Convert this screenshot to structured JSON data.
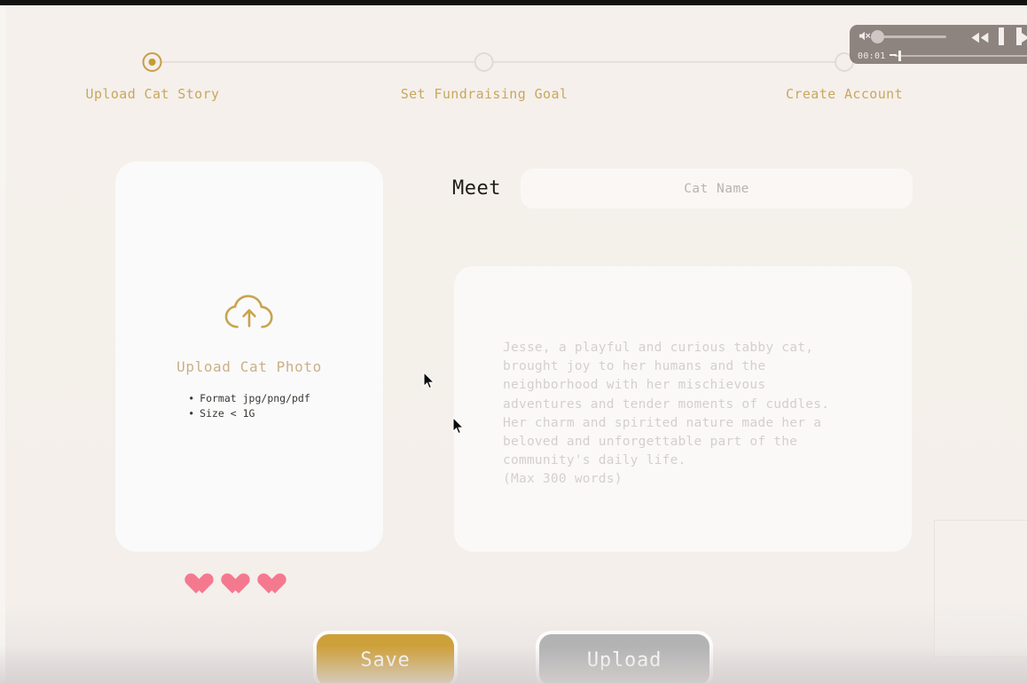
{
  "stepper": {
    "steps": [
      {
        "label": "Upload Cat Story",
        "state": "active"
      },
      {
        "label": "Set Fundraising Goal",
        "state": "inactive"
      },
      {
        "label": "Create Account",
        "state": "inactive"
      }
    ],
    "accent_color": "#c9a760",
    "active_dot_color": "#c59b33",
    "track_color": "#e7dfd9"
  },
  "upload_card": {
    "icon": "cloud-upload-icon",
    "title": "Upload Cat Photo",
    "requirements": [
      "Format jpg/png/pdf",
      "Size < 1G"
    ],
    "title_color": "#cbb087",
    "card_color": "#fafafa"
  },
  "hearts": {
    "count": 3,
    "color": "#f4798f"
  },
  "story_form": {
    "meet_label": "Meet",
    "cat_name": {
      "value": "",
      "placeholder": "Cat Name"
    },
    "story": {
      "value": "",
      "placeholder": "Jesse, a playful and curious tabby cat,\nbrought joy to her humans and the\nneighborhood with her mischievous\nadventures and tender moments of cuddles.\nHer charm and spirited nature made her a\nbeloved and unforgettable part of the\ncommunity's daily life.\n(Max 300 words)"
    }
  },
  "actions": {
    "save_label": "Save",
    "upload_label": "Upload",
    "save_color": "#cea03a",
    "upload_color": "#b3b3b3"
  },
  "video_controls": {
    "time": "00:01",
    "mute_icon": "speaker-muted-icon",
    "rewind_icon": "rewind-icon",
    "pause_icon": "pause-icon",
    "forward_icon": "fast-forward-icon",
    "volume_level": 0,
    "overlay_color": "#766a66"
  },
  "cursors": {
    "main": "arrow-cursor",
    "secondary": "arrow-cursor"
  }
}
